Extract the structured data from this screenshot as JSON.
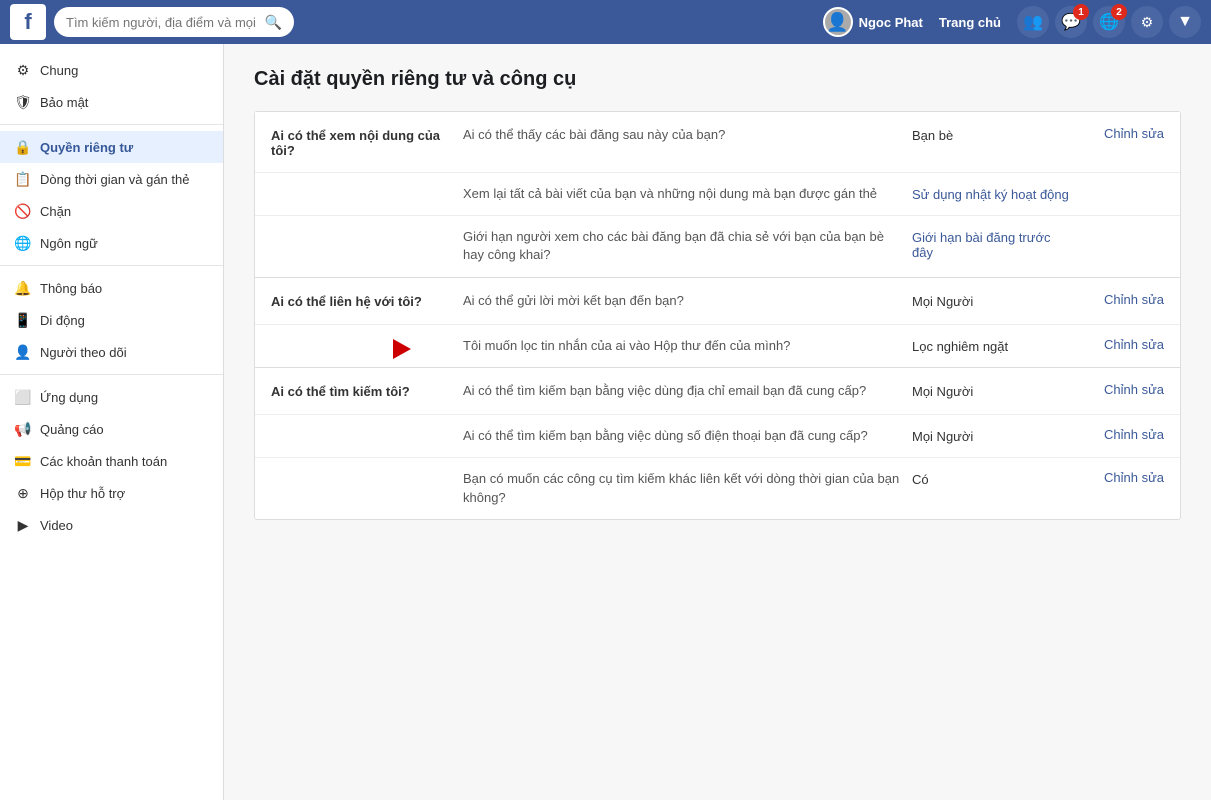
{
  "header": {
    "logo": "f",
    "search_placeholder": "Tìm kiếm người, địa điểm và mọi thứ",
    "user_name": "Ngoc Phat",
    "home_label": "Trang chủ",
    "notifications_count": "1",
    "messages_count": "2"
  },
  "sidebar": {
    "items": [
      {
        "id": "chung",
        "label": "Chung",
        "icon": "⚙",
        "active": false
      },
      {
        "id": "bao-mat",
        "label": "Bảo mật",
        "icon": "🛡",
        "active": false
      },
      {
        "id": "divider1",
        "type": "divider"
      },
      {
        "id": "quyen-rieng-tu",
        "label": "Quyền riêng tư",
        "icon": "🔒",
        "active": true
      },
      {
        "id": "dong-thoi-gian",
        "label": "Dòng thời gian và gán thẻ",
        "icon": "📋",
        "active": false
      },
      {
        "id": "chan",
        "label": "Chặn",
        "icon": "🚫",
        "active": false
      },
      {
        "id": "ngon-ngu",
        "label": "Ngôn ngữ",
        "icon": "🌐",
        "active": false
      },
      {
        "id": "divider2",
        "type": "divider"
      },
      {
        "id": "thong-bao",
        "label": "Thông báo",
        "icon": "🔔",
        "active": false
      },
      {
        "id": "di-dong",
        "label": "Di động",
        "icon": "📱",
        "active": false
      },
      {
        "id": "nguoi-theo-doi",
        "label": "Người theo dõi",
        "icon": "👤",
        "active": false
      },
      {
        "id": "divider3",
        "type": "divider"
      },
      {
        "id": "ung-dung",
        "label": "Ứng dụng",
        "icon": "⬜",
        "active": false
      },
      {
        "id": "quang-cao",
        "label": "Quảng cáo",
        "icon": "📢",
        "active": false
      },
      {
        "id": "cac-khoan",
        "label": "Các khoản thanh toán",
        "icon": "💳",
        "active": false
      },
      {
        "id": "hop-thu",
        "label": "Hộp thư hỗ trợ",
        "icon": "⊕",
        "active": false
      },
      {
        "id": "video",
        "label": "Video",
        "icon": "▶",
        "active": false
      }
    ]
  },
  "main": {
    "title": "Cài đặt quyền riêng tư và công cụ",
    "sections": [
      {
        "id": "xem-noi-dung",
        "heading": "Ai có thể xem nội dung của tôi?",
        "rows": [
          {
            "desc": "Ai có thể thấy các bài đăng sau này của bạn?",
            "value": "Bạn bè",
            "action": "Chỉnh sửa"
          },
          {
            "desc": "Xem lại tất cả bài viết của bạn và những nội dung mà bạn được gán thẻ",
            "value": "Sử dụng nhật ký hoạt động",
            "action": ""
          },
          {
            "desc": "Giới hạn người xem cho các bài đăng bạn đã chia sẻ với bạn của bạn bè hay công khai?",
            "value": "Giới hạn bài đăng trước đây",
            "action": ""
          }
        ]
      },
      {
        "id": "lien-he",
        "heading": "Ai có thể liên hệ với tôi?",
        "rows": [
          {
            "desc": "Ai có thể gửi lời mời kết bạn đến bạn?",
            "value": "Mọi Người",
            "action": "Chỉnh sửa"
          },
          {
            "desc": "Tôi muốn lọc tin nhắn của ai vào Hộp thư đến của mình?",
            "value": "Lọc nghiêm ngặt",
            "action": "Chỉnh sửa",
            "arrow": true
          }
        ]
      },
      {
        "id": "tim-kiem",
        "heading": "Ai có thể tìm kiếm tôi?",
        "rows": [
          {
            "desc": "Ai có thể tìm kiếm bạn bằng việc dùng địa chỉ email bạn đã cung cấp?",
            "value": "Mọi Người",
            "action": "Chỉnh sửa"
          },
          {
            "desc": "Ai có thể tìm kiếm bạn bằng việc dùng số điện thoại bạn đã cung cấp?",
            "value": "Mọi Người",
            "action": "Chỉnh sửa"
          },
          {
            "desc": "Bạn có muốn các công cụ tìm kiếm khác liên kết với dòng thời gian của bạn không?",
            "value": "Có",
            "action": "Chỉnh sửa"
          }
        ]
      }
    ]
  }
}
